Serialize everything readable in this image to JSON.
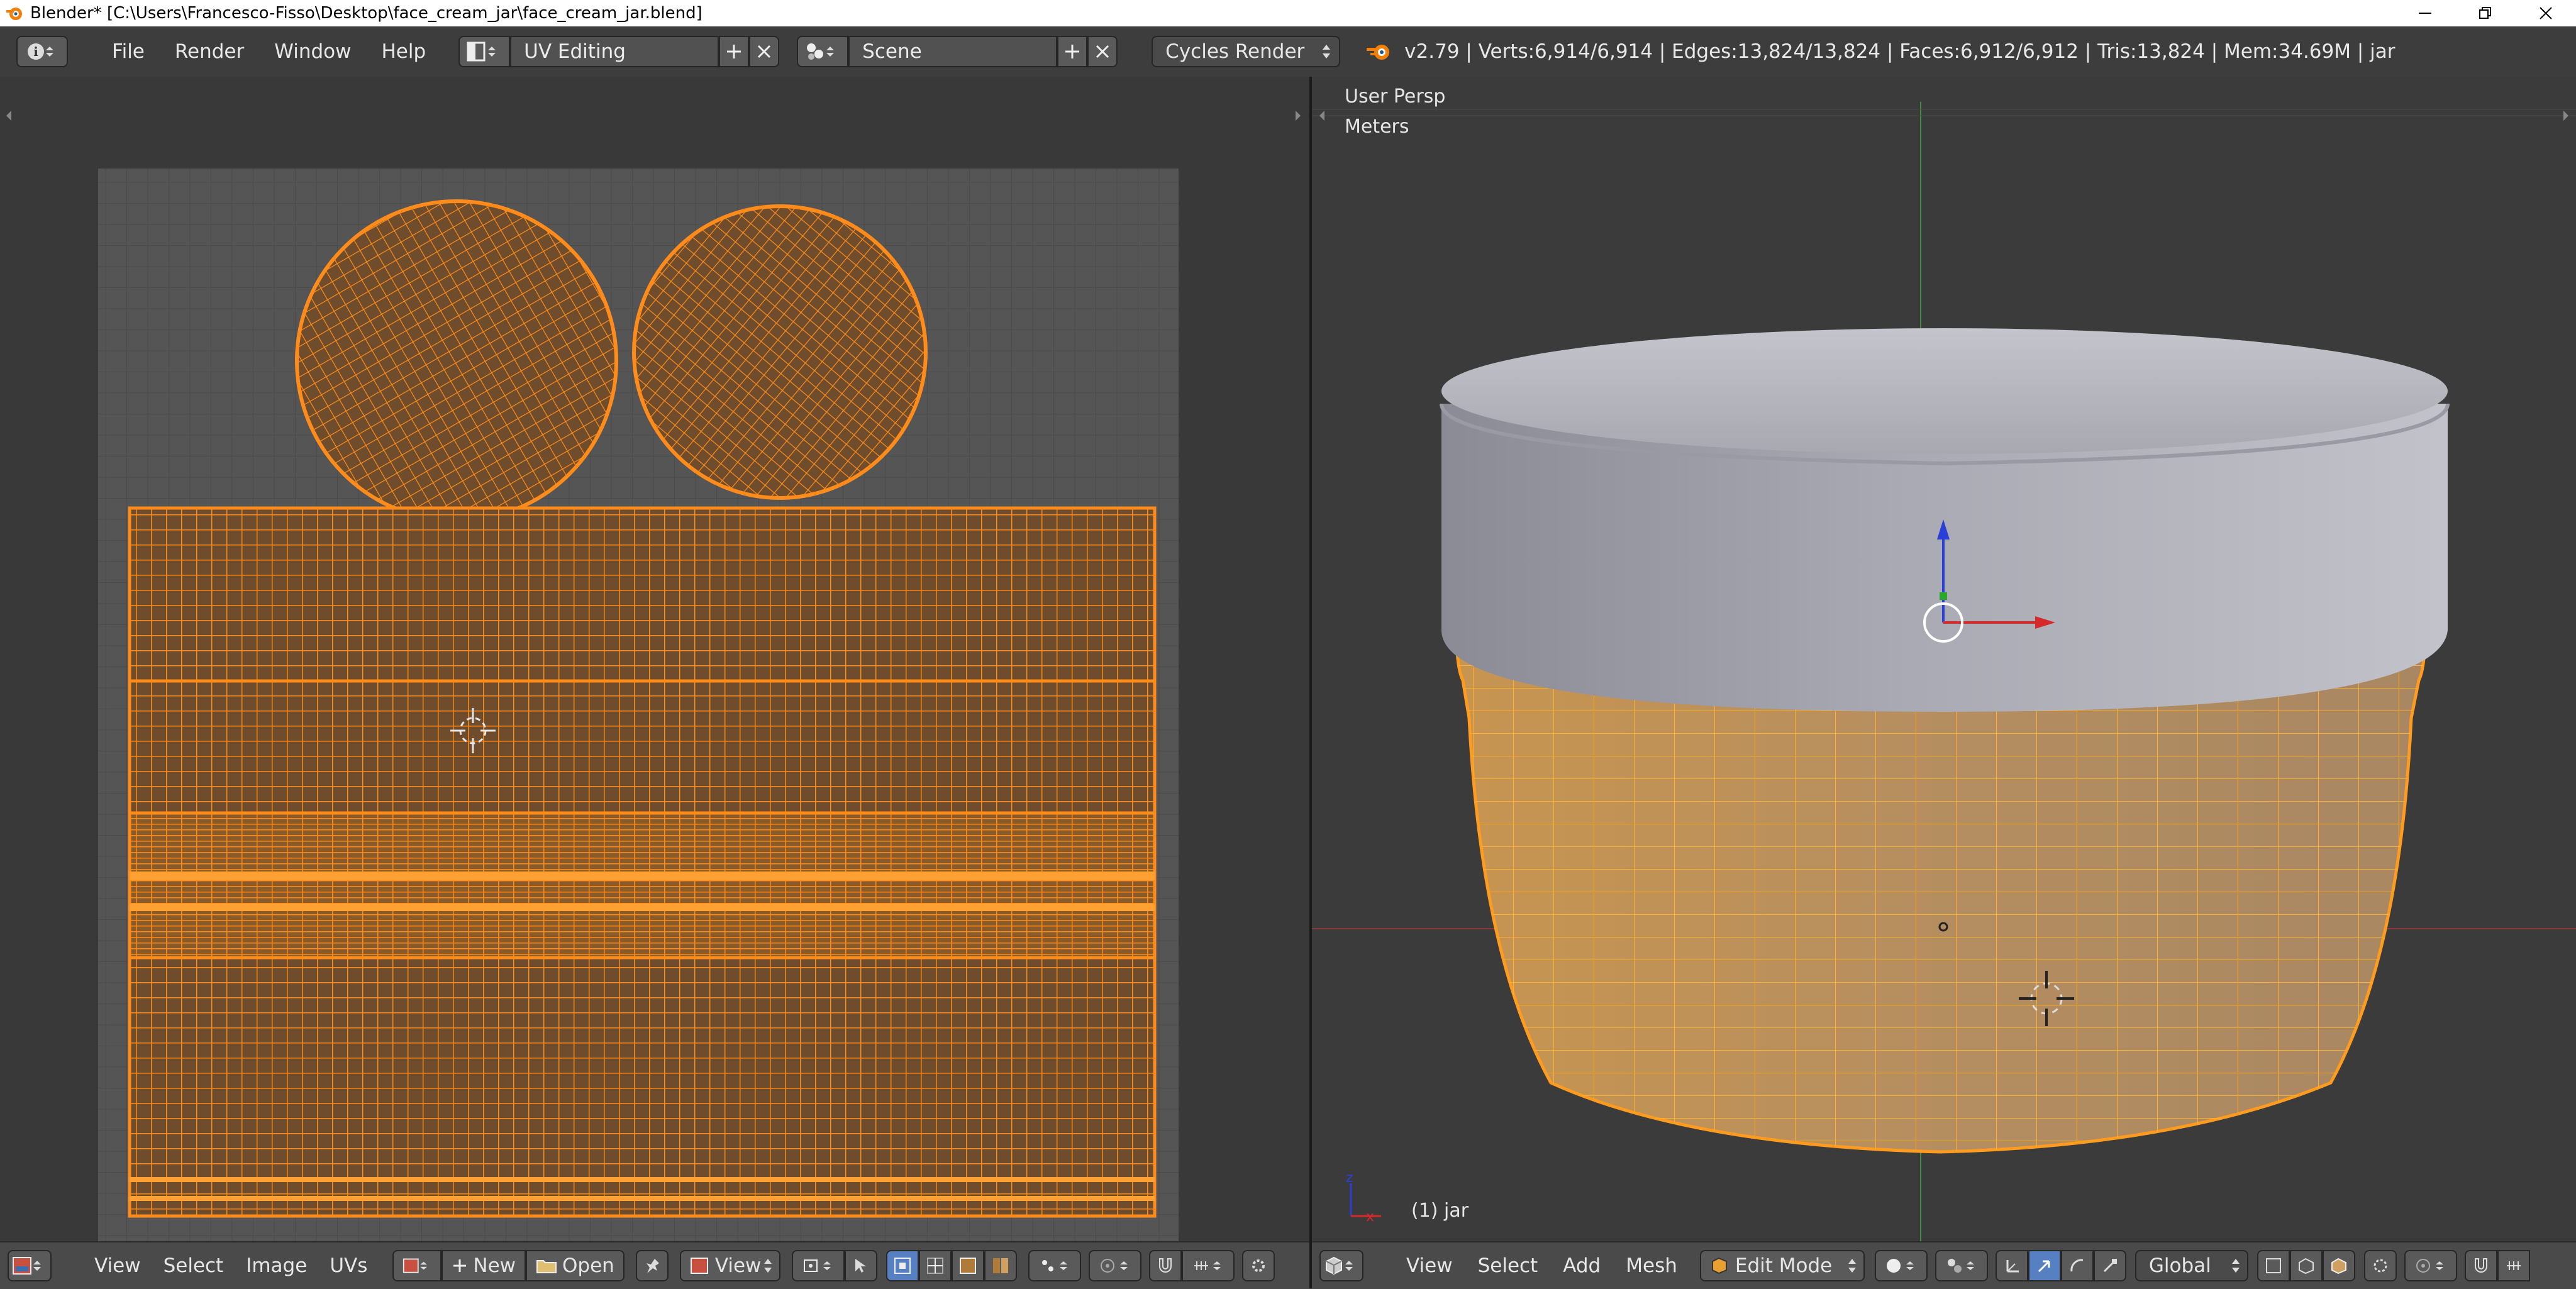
{
  "window": {
    "title": "Blender* [C:\\Users\\Francesco-Fisso\\Desktop\\face_cream_jar\\face_cream_jar.blend]"
  },
  "info_header": {
    "menus": [
      "File",
      "Render",
      "Window",
      "Help"
    ],
    "screen_layout": "UV Editing",
    "scene": "Scene",
    "render_engine": "Cycles Render",
    "stats": "v2.79 | Verts:6,914/6,914 | Edges:13,824/13,824 | Faces:6,912/6,912 | Tris:13,824 | Mem:34.69M | jar"
  },
  "uv_editor": {
    "footer": {
      "menus": [
        "View",
        "Select",
        "Image",
        "UVs"
      ],
      "new_label": "New",
      "open_label": "Open",
      "view_label": "View"
    }
  },
  "viewport": {
    "view_name": "User Persp",
    "units": "Meters",
    "object_label": "(1) jar",
    "footer": {
      "menus": [
        "View",
        "Select",
        "Add",
        "Mesh"
      ],
      "mode": "Edit Mode",
      "orientation": "Global"
    }
  },
  "colors": {
    "uv_selected": "#ff8c1a",
    "uv_fill": "#6e4c2c",
    "grid_bg": "#555555",
    "lid": "#a9a9b3",
    "jar_body": "#c59a5c",
    "active_button": "#5680c2"
  },
  "icons": [
    "info-icon",
    "screen-layout-icon",
    "scene-icon",
    "add-icon",
    "close-icon",
    "blender-logo-icon",
    "pin-icon",
    "cursor-icon",
    "mesh-object-icon",
    "shading-icon",
    "manipulator-icon"
  ]
}
